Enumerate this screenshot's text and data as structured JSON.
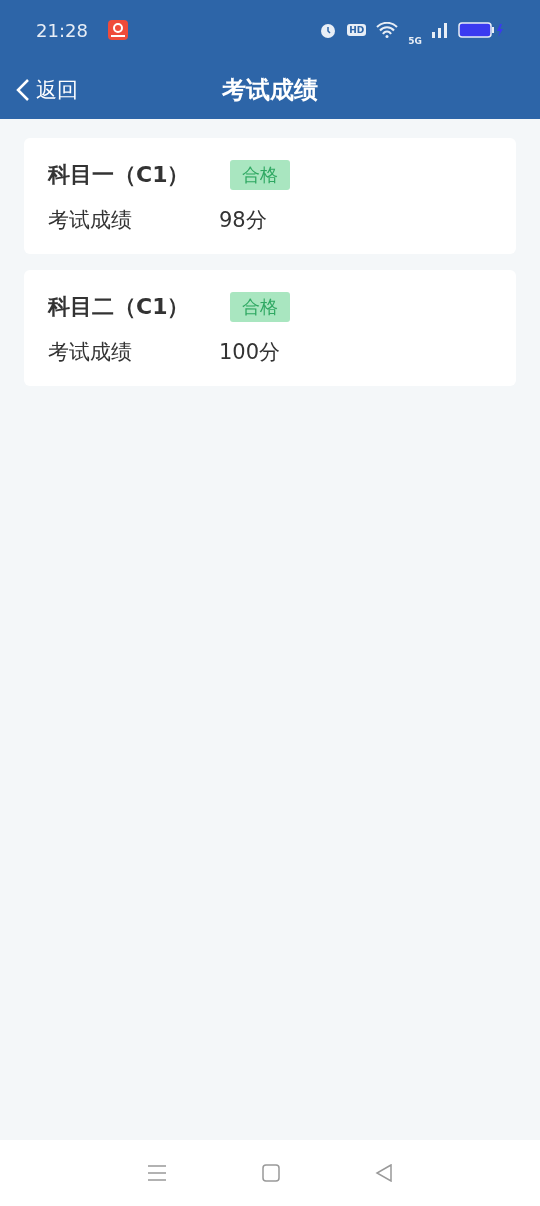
{
  "status_bar": {
    "time": "21:28",
    "hd_label": "HD",
    "network_label": "5G"
  },
  "nav": {
    "back": "返回",
    "title": "考试成绩"
  },
  "results": [
    {
      "subject": "科目一（C1）",
      "badge": "合格",
      "label": "考试成绩",
      "score": "98分"
    },
    {
      "subject": "科目二（C1）",
      "badge": "合格",
      "label": "考试成绩",
      "score": "100分"
    }
  ]
}
